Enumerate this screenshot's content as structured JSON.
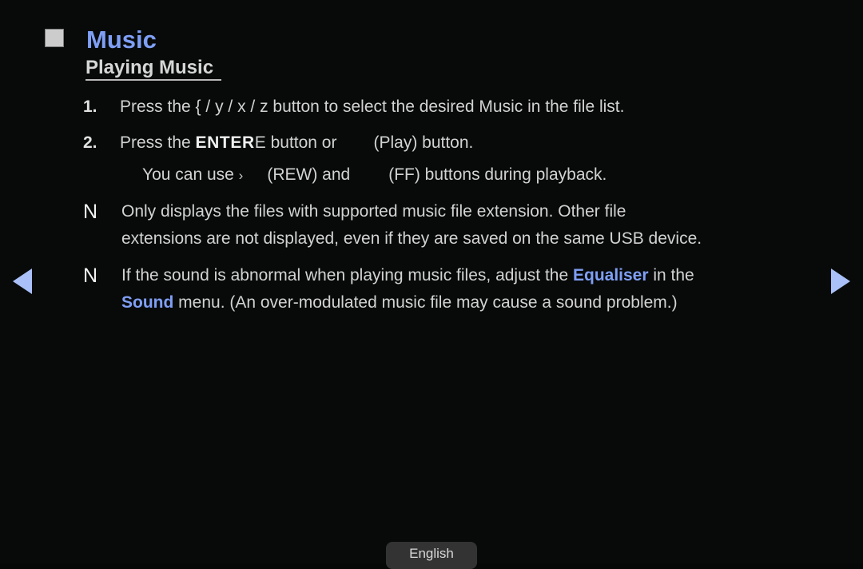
{
  "header": {
    "bullet_icon": "filled-square-icon",
    "title": "Music"
  },
  "section": {
    "heading": "Playing Music"
  },
  "steps": [
    {
      "number": "1.",
      "text_before_keys": "Press the ",
      "keys": "{ / y / x / z",
      "text_after_keys": " button to select the desired Music in the file list."
    },
    {
      "number": "2.",
      "text_before_key": "Press the ",
      "key_bold": "ENTER",
      "key_missing_glyph": "E",
      "text_middle": " button or",
      "text_after_icon": "(Play) button."
    }
  ],
  "substep": {
    "text_before": "You can use ",
    "chevron": "›",
    "text_rew": "(REW) and",
    "text_ff": "(FF) buttons during playback."
  },
  "notes": [
    {
      "marker": "N",
      "line1": "Only displays the files with supported music file extension. Other file",
      "line2": "extensions are not displayed, even if they are saved on the same USB device."
    },
    {
      "marker": "N",
      "line1_a": "If the sound is abnormal when playing music files, adjust the ",
      "line1_highlight": "Equaliser",
      "line1_b": " in the",
      "line2_highlight": "Sound",
      "line2_b": " menu. (An over-modulated music file may cause a sound problem.)"
    }
  ],
  "navigation": {
    "prev_icon": "triangle-left-icon",
    "next_icon": "triangle-right-icon"
  },
  "footer": {
    "language_label": "English"
  },
  "colors": {
    "background": "#080a0a",
    "accent_blue": "#7f9ff5",
    "arrow_blue": "#a9c0f8",
    "body_text": "#d2d2d2",
    "bullet_square": "#cccccc",
    "button_bg": "#333333"
  }
}
